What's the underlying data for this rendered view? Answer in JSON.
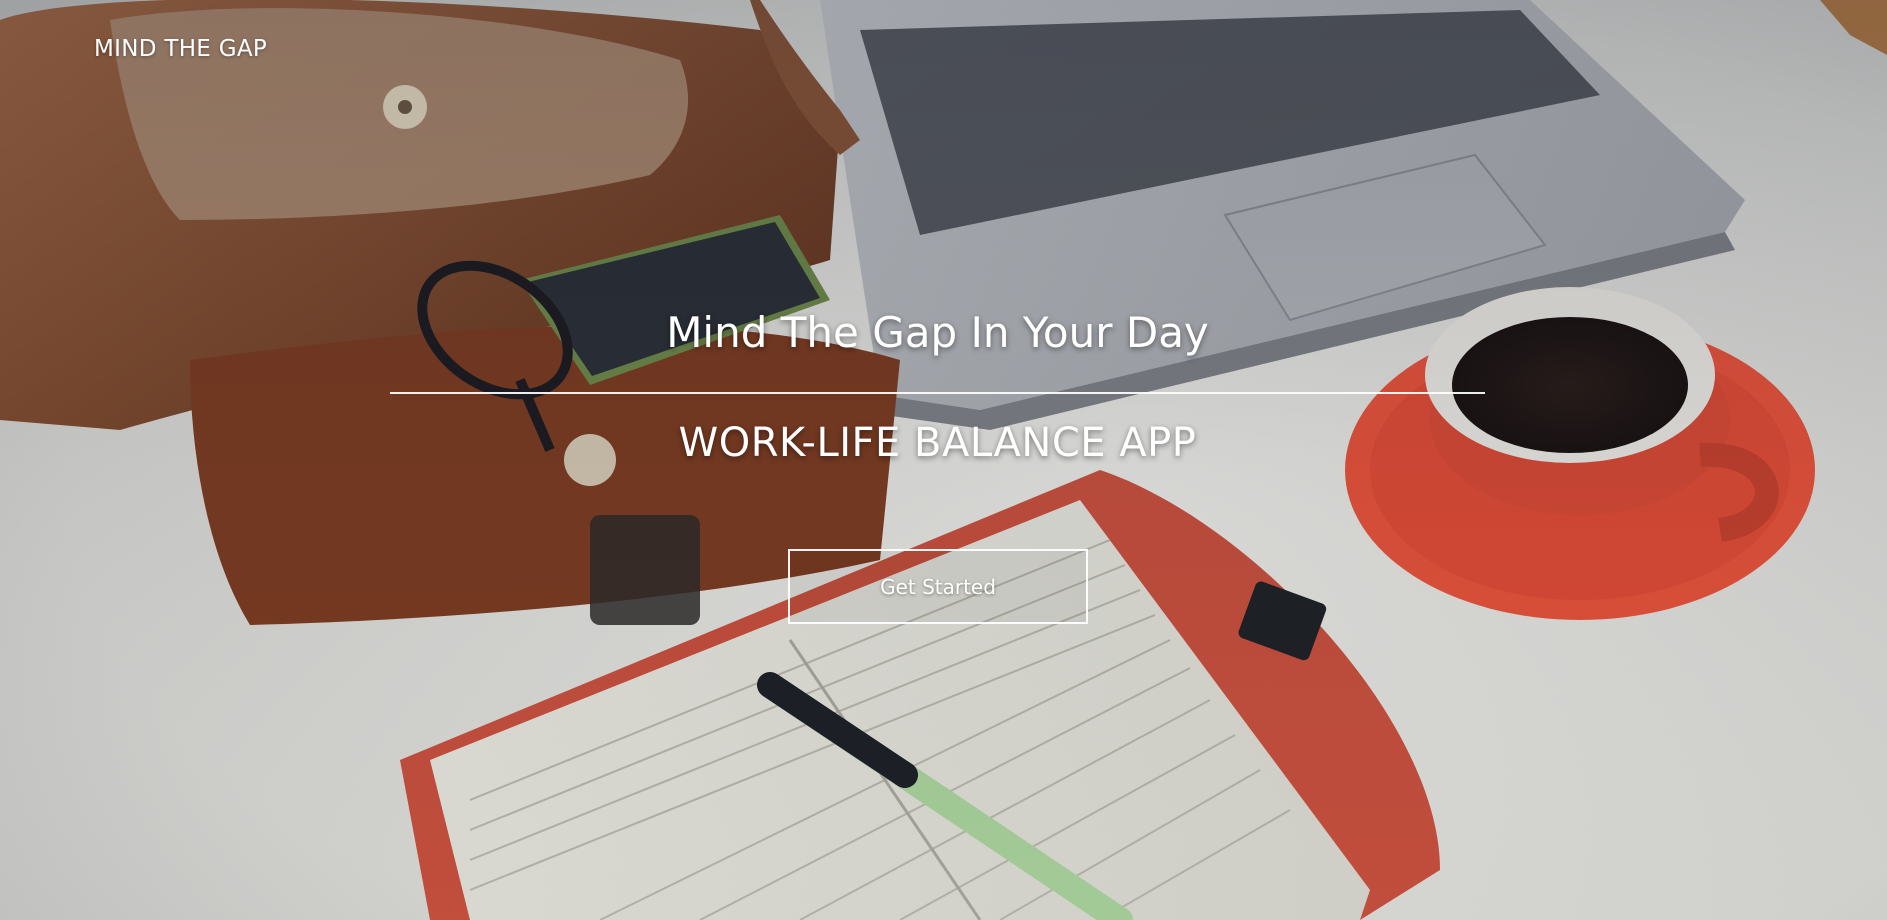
{
  "header": {
    "brand": "MIND THE GAP"
  },
  "hero": {
    "title": "Mind The Gap In Your Day",
    "subtitle": "WORK-LIFE BALANCE APP",
    "cta_label": "Get Started"
  },
  "background": {
    "description_icon": "desk-photo-background"
  },
  "colors": {
    "text": "#ffffff",
    "saucer": "#e8533a",
    "notebook_cover": "#d9533f",
    "bag": "#8a4a2a"
  }
}
